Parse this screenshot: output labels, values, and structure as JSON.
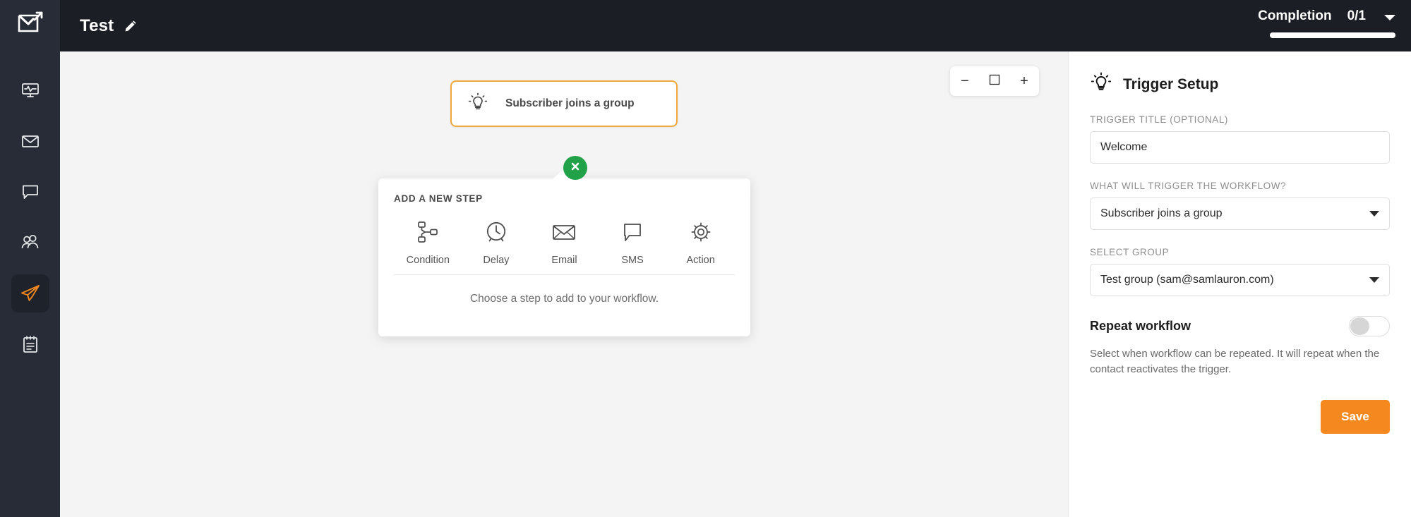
{
  "colors": {
    "sidebar_bg": "#272c36",
    "header_bg": "#1b1e24",
    "canvas_bg": "#f4f4f4",
    "accent_orange": "#f5881f",
    "trigger_border": "#f0a93c",
    "close_green": "#21a148"
  },
  "sidebar": {
    "logo_icon": "envelope-arrow-logo-icon",
    "items": [
      {
        "icon": "dashboard-monitor-icon",
        "name": "dashboard",
        "active": false
      },
      {
        "icon": "envelope-icon",
        "name": "campaigns",
        "active": false
      },
      {
        "icon": "chat-bubble-icon",
        "name": "messages",
        "active": false
      },
      {
        "icon": "subscribers-people-icon",
        "name": "subscribers",
        "active": false
      },
      {
        "icon": "paper-plane-icon",
        "name": "automation",
        "active": true
      },
      {
        "icon": "notepad-forms-icon",
        "name": "forms",
        "active": false
      }
    ]
  },
  "header": {
    "workflow_title": "Test",
    "edit_icon": "pencil-icon",
    "completion_label": "Completion",
    "completion_count": "0/1",
    "completion_progress_percent": 100,
    "dropdown_icon": "chevron-down-icon"
  },
  "canvas": {
    "trigger_card": {
      "icon": "lightbulb-icon",
      "label": "Subscriber joins a group"
    },
    "close_button_icon": "close-x-icon",
    "zoom_controls": {
      "zoom_out_label": "−",
      "fit_icon": "fit-to-screen-icon",
      "zoom_in_label": "+"
    },
    "step_popup": {
      "title": "ADD A NEW STEP",
      "hint": "Choose a step to add to your workflow.",
      "steps": [
        {
          "label": "Condition",
          "icon": "branch-condition-icon"
        },
        {
          "label": "Delay",
          "icon": "clock-icon"
        },
        {
          "label": "Email",
          "icon": "envelope-icon"
        },
        {
          "label": "SMS",
          "icon": "chat-bubble-icon"
        },
        {
          "label": "Action",
          "icon": "gear-icon"
        }
      ]
    }
  },
  "panel": {
    "icon": "lightbulb-icon",
    "title": "Trigger Setup",
    "trigger_title_label": "TRIGGER TITLE (OPTIONAL)",
    "trigger_title_value": "Welcome",
    "trigger_title_placeholder": "Trigger title",
    "trigger_select_label": "WHAT WILL TRIGGER THE WORKFLOW?",
    "trigger_select_value": "Subscriber joins a group",
    "group_select_label": "SELECT GROUP",
    "group_select_value": "Test group (sam@samlauron.com)",
    "repeat_label": "Repeat workflow",
    "repeat_enabled": false,
    "repeat_description": "Select when workflow can be repeated. It will repeat when the contact reactivates the trigger.",
    "save_label": "Save"
  }
}
